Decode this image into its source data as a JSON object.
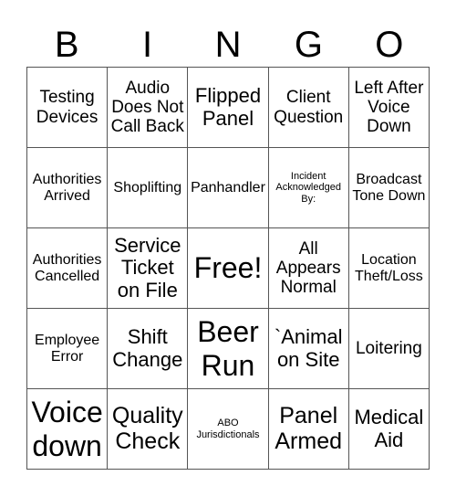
{
  "header": {
    "letters": [
      "B",
      "I",
      "N",
      "G",
      "O"
    ]
  },
  "cells": [
    [
      "Testing Devices",
      "Audio Does Not Call Back",
      "Flipped Panel",
      "Client Question",
      "Left After Voice Down"
    ],
    [
      "Authorities Arrived",
      "Shoplifting",
      "Panhandler",
      "Incident Acknowledged By:",
      "Broadcast Tone Down"
    ],
    [
      "Authorities Cancelled",
      "Service Ticket on File",
      "Free!",
      "All Appears Normal",
      "Location Theft/Loss"
    ],
    [
      "Employee Error",
      "Shift Change",
      "Beer Run",
      "`Animal on Site",
      "Loitering"
    ],
    [
      "Voice down",
      "Quality Check",
      "ABO Jurisdictionals",
      "Panel Armed",
      "Medical Aid"
    ]
  ]
}
